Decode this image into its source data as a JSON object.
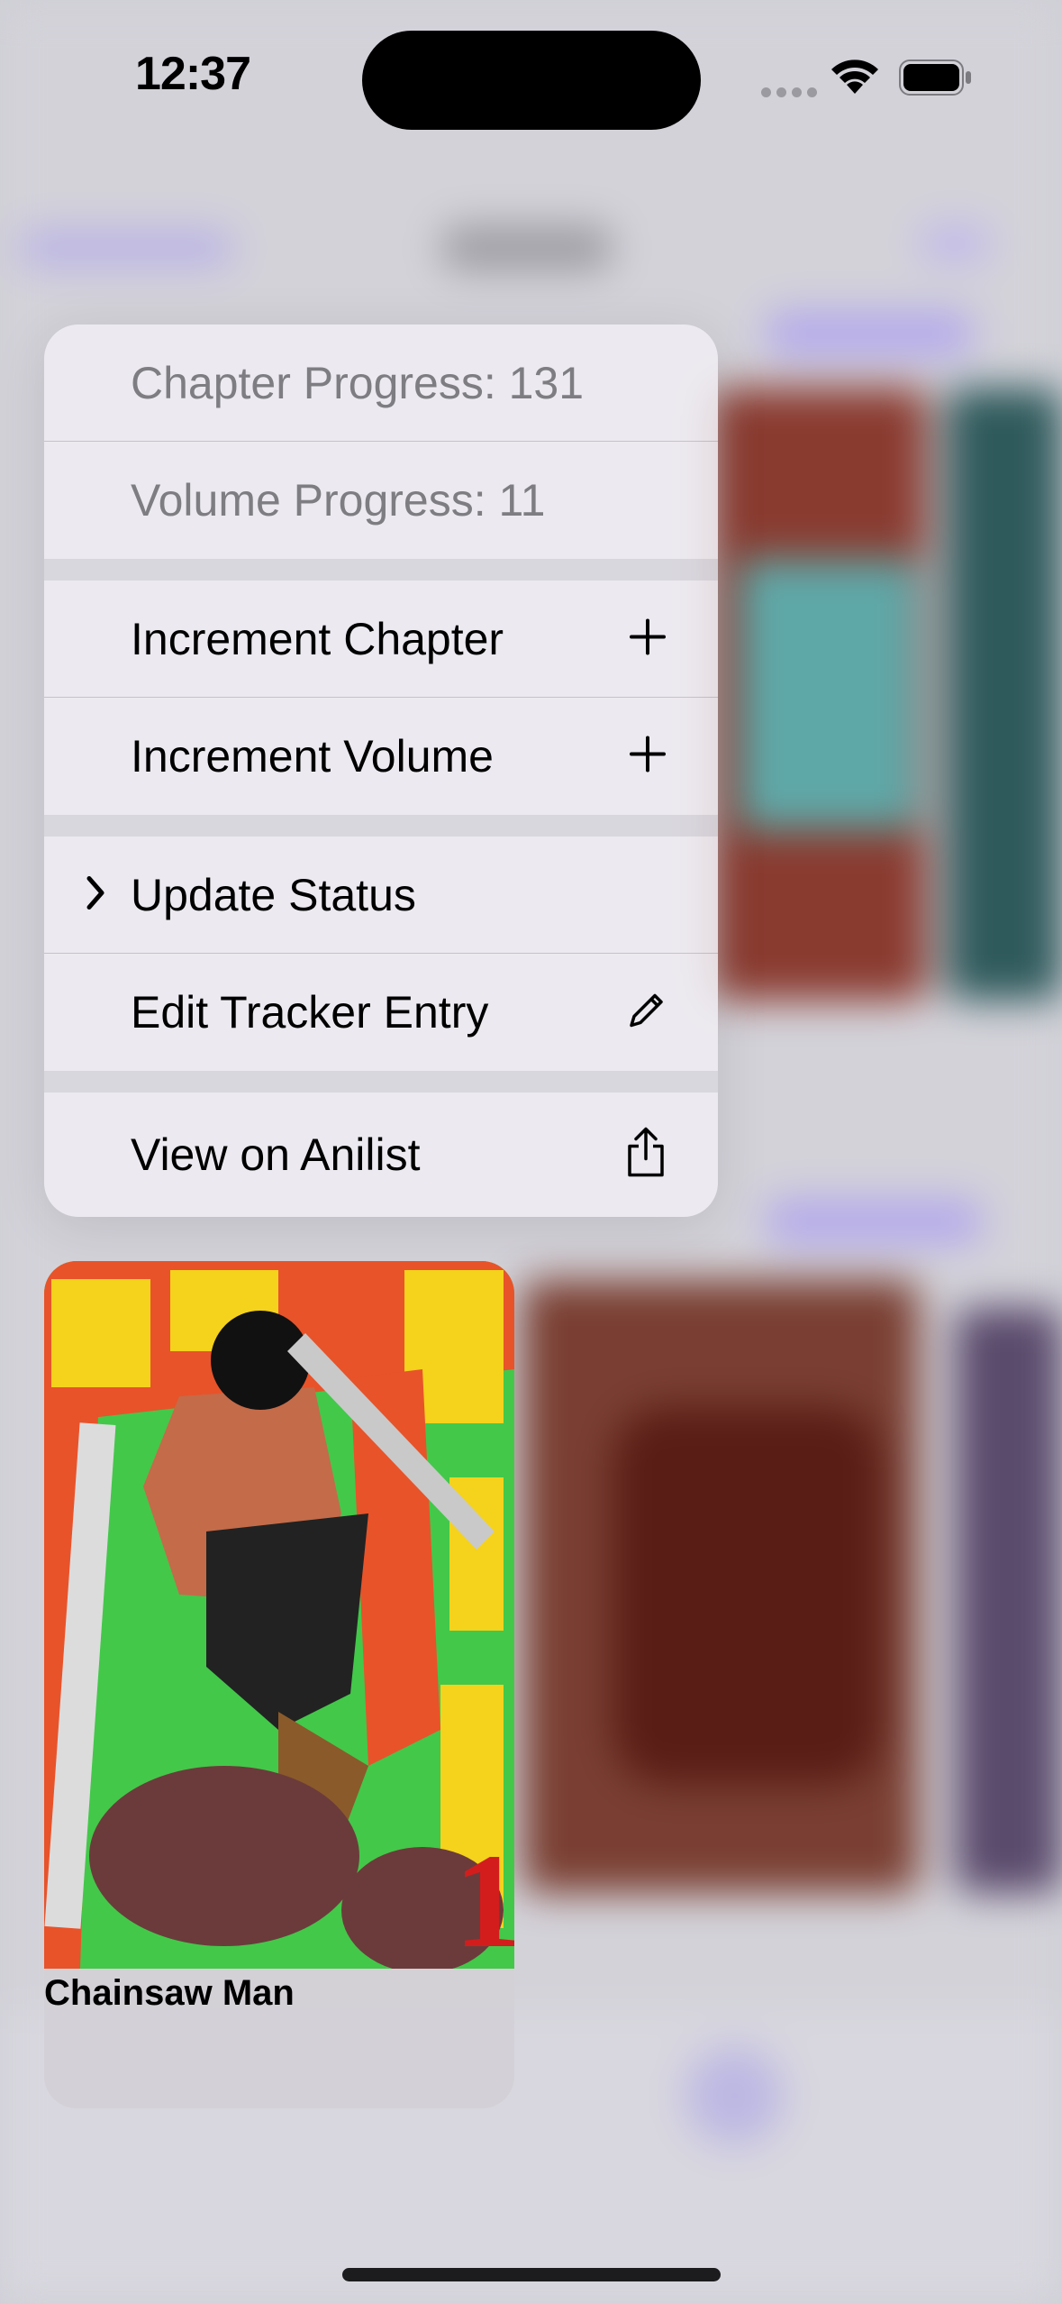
{
  "status_bar": {
    "time": "12:37"
  },
  "context_menu": {
    "info_items": [
      {
        "label": "Chapter Progress: 131"
      },
      {
        "label": "Volume Progress: 11"
      }
    ],
    "increment_items": [
      {
        "label": "Increment Chapter",
        "icon": "plus-icon"
      },
      {
        "label": "Increment Volume",
        "icon": "plus-icon"
      }
    ],
    "manage_items": [
      {
        "label": "Update Status",
        "icon": "chevron-right-icon"
      },
      {
        "label": "Edit Tracker Entry",
        "icon": "pencil-icon"
      }
    ],
    "link_items": [
      {
        "label": "View on Anilist",
        "icon": "share-icon"
      }
    ]
  },
  "preview_card": {
    "title": "Chainsaw Man",
    "cover_colors": {
      "background": "#43c84a",
      "orange": "#e8532a",
      "yellow": "#f5d21c",
      "red": "#d31d1d"
    }
  },
  "colors": {
    "accent": "#6e5ce0",
    "dim_text": "#7d7d82"
  }
}
